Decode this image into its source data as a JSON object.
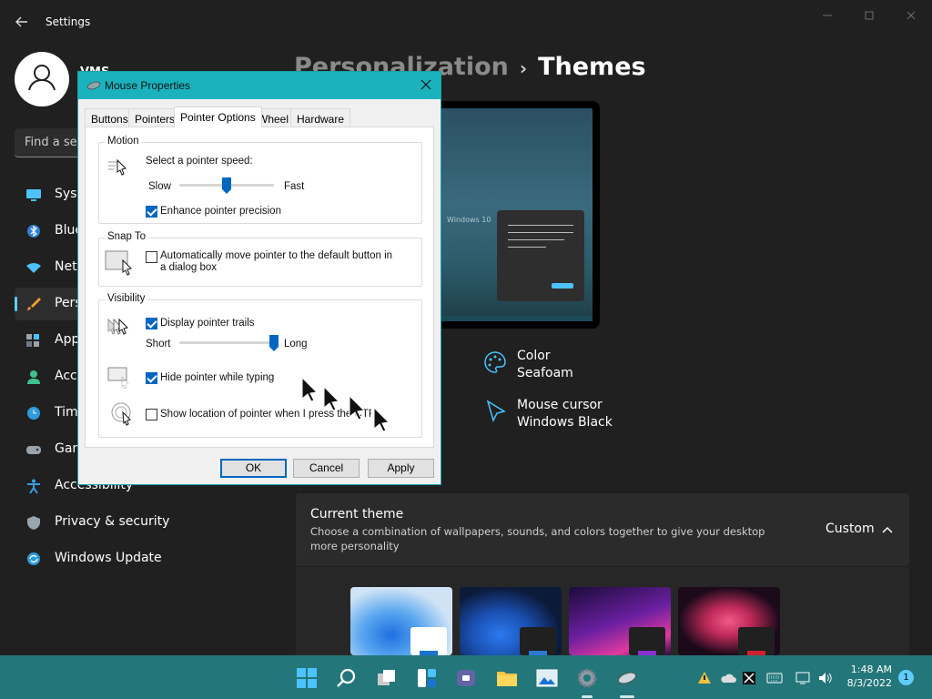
{
  "window": {
    "title": "Settings",
    "minimize_icon": "minimize-icon",
    "maximize_icon": "restore-icon",
    "close_icon": "close-icon"
  },
  "user": {
    "name": "VMS"
  },
  "search": {
    "placeholder": "Find a set"
  },
  "sidebar": {
    "items": [
      {
        "label": "Syst",
        "icon": "system-icon"
      },
      {
        "label": "Blue",
        "icon": "bluetooth-icon"
      },
      {
        "label": "Netv",
        "icon": "network-icon"
      },
      {
        "label": "Pers",
        "icon": "personalization-icon",
        "active": true
      },
      {
        "label": "App",
        "icon": "apps-icon"
      },
      {
        "label": "Acco",
        "icon": "accounts-icon"
      },
      {
        "label": "Time",
        "icon": "time-icon"
      },
      {
        "label": "Gam",
        "icon": "gaming-icon"
      },
      {
        "label": "Accessibility",
        "icon": "accessibility-icon"
      },
      {
        "label": "Privacy & security",
        "icon": "shield-icon"
      },
      {
        "label": "Windows Update",
        "icon": "windows-update-icon"
      }
    ]
  },
  "breadcrumb": {
    "parent": "Personalization",
    "separator": "›",
    "current": "Themes"
  },
  "preview": {
    "label": "Windows 10"
  },
  "properties": [
    {
      "icon": "palette-icon",
      "label": "Color",
      "value": "Seafoam"
    },
    {
      "icon": "cursor-icon",
      "label": "Mouse cursor",
      "value": "Windows Black"
    }
  ],
  "current_theme": {
    "title": "Current theme",
    "description": "Choose a combination of wallpapers, sounds, and colors together to give your desktop more personality",
    "value": "Custom"
  },
  "dialog": {
    "title": "Mouse Properties",
    "tabs": [
      "Buttons",
      "Pointers",
      "Pointer Options",
      "Wheel",
      "Hardware"
    ],
    "selected_tab": "Pointer Options",
    "motion": {
      "heading": "Motion",
      "speed_label": "Select a pointer speed:",
      "slow": "Slow",
      "fast": "Fast",
      "speed_value": 0.5,
      "precision_label": "Enhance pointer precision",
      "precision_checked": true
    },
    "snap": {
      "heading": "Snap To",
      "label": "Automatically move pointer to the default button in a dialog box",
      "checked": false
    },
    "visibility": {
      "heading": "Visibility",
      "trails_label": "Display pointer trails",
      "trails_checked": true,
      "short": "Short",
      "long": "Long",
      "trail_value": 1.0,
      "hide_label": "Hide pointer while typing",
      "hide_checked": true,
      "show_label": "Show location of pointer when I press the CTRL key",
      "show_checked": false
    },
    "buttons": {
      "ok": "OK",
      "cancel": "Cancel",
      "apply": "Apply"
    }
  },
  "taskbar": {
    "clock_time": "1:48 AM",
    "clock_date": "8/3/2022",
    "notification_count": "1",
    "accent": "#237679"
  }
}
